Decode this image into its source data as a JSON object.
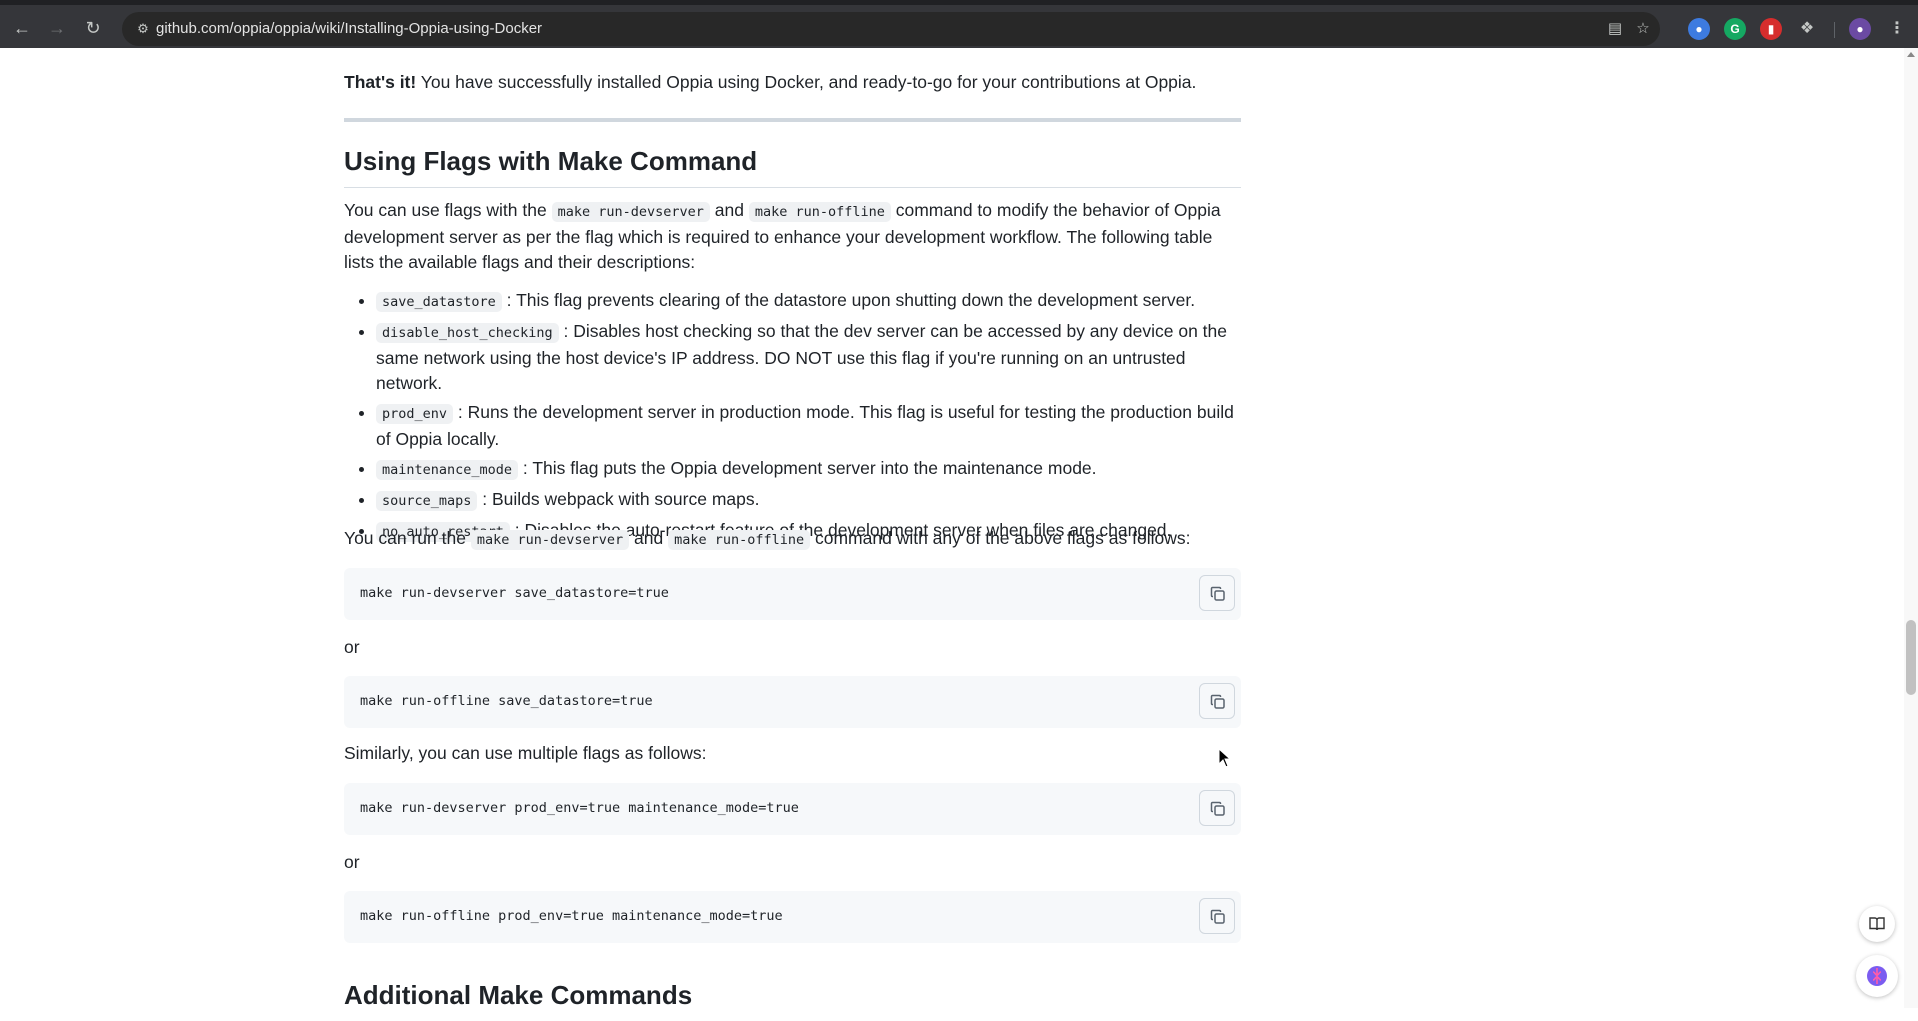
{
  "browser": {
    "url": "github.com/oppia/oppia/wiki/Installing-Oppia-using-Docker"
  },
  "article": {
    "success_strong": "That's it!",
    "success_rest": " You have successfully installed Oppia using Docker, and ready-to-go for your contributions at Oppia.",
    "heading_flags": "Using Flags with Make Command",
    "intro": {
      "t1": "You can use flags with the ",
      "c1": "make run-devserver",
      "t2": " and ",
      "c2": "make run-offline",
      "t3": " command to modify the behavior of Oppia development server as per the flag which is required to enhance your development workflow. The following table lists the available flags and their descriptions:"
    },
    "flags": [
      {
        "name": "save_datastore",
        "desc": " : This flag prevents clearing of the datastore upon shutting down the development server."
      },
      {
        "name": "disable_host_checking",
        "desc": " : Disables host checking so that the dev server can be accessed by any device on the same network using the host device's IP address. DO NOT use this flag if you're running on an untrusted network."
      },
      {
        "name": "prod_env",
        "desc": " : Runs the development server in production mode. This flag is useful for testing the production build of Oppia locally."
      },
      {
        "name": "maintenance_mode",
        "desc": " : This flag puts the Oppia development server into the maintenance mode."
      },
      {
        "name": "source_maps",
        "desc": " : Builds webpack with source maps."
      },
      {
        "name": "no_auto_restart",
        "desc": " : Disables the auto-restart feature of the development server when files are changed."
      }
    ],
    "run_para": {
      "t1": "You can run the ",
      "c1": "make run-devserver",
      "t2": " and ",
      "c2": "make run-offline",
      "t3": " command with any of the above flags as follows:"
    },
    "code1": "make run-devserver save_datastore=true",
    "or1": "or",
    "code2": "make run-offline save_datastore=true",
    "similarly": "Similarly, you can use multiple flags as follows:",
    "code3": "make run-devserver prod_env=true maintenance_mode=true",
    "or2": "or",
    "code4": "make run-offline prod_env=true maintenance_mode=true",
    "heading_additional": "Additional Make Commands"
  }
}
